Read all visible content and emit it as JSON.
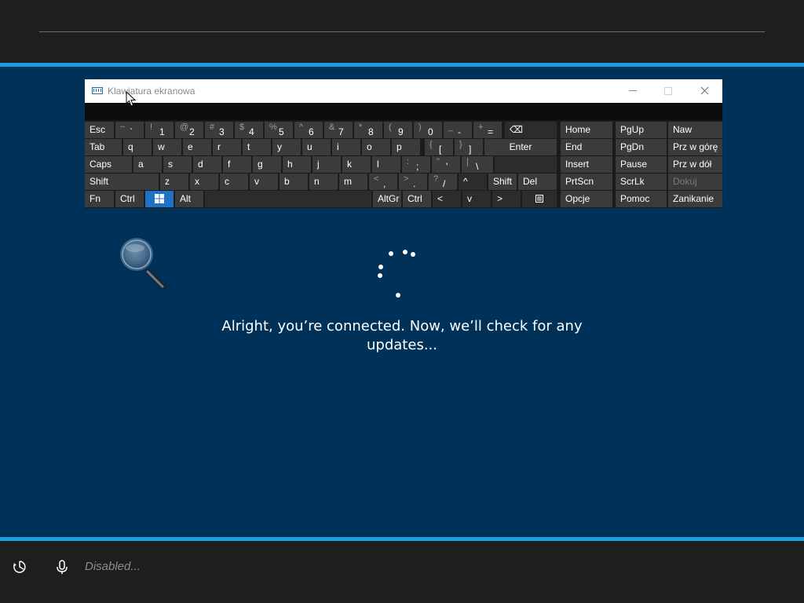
{
  "window": {
    "title": "Klawiatura ekranowa",
    "minimize_icon": "minimize-icon",
    "maximize_icon": "maximize-icon",
    "close_icon": "close-icon"
  },
  "keyboard": {
    "row1": [
      {
        "label": "Esc"
      },
      {
        "shift": "~",
        "primary": "`"
      },
      {
        "shift": "!",
        "primary": "1"
      },
      {
        "shift": "@",
        "primary": "2"
      },
      {
        "shift": "#",
        "primary": "3"
      },
      {
        "shift": "$",
        "primary": "4"
      },
      {
        "shift": "%",
        "primary": "5"
      },
      {
        "shift": "^",
        "primary": "6"
      },
      {
        "shift": "&",
        "primary": "7"
      },
      {
        "shift": "*",
        "primary": "8"
      },
      {
        "shift": "(",
        "primary": "9"
      },
      {
        "shift": ")",
        "primary": "0"
      },
      {
        "shift": "_",
        "primary": "-"
      },
      {
        "shift": "+",
        "primary": "="
      },
      {
        "label": "⌫"
      }
    ],
    "row2": [
      "Tab",
      "q",
      "w",
      "e",
      "r",
      "t",
      "y",
      "u",
      "i",
      "o",
      "p",
      "Enter"
    ],
    "row2_brackets": [
      {
        "shift": "{",
        "primary": "["
      },
      {
        "shift": "}",
        "primary": "]"
      }
    ],
    "row3": [
      "Caps",
      "a",
      "s",
      "d",
      "f",
      "g",
      "h",
      "j",
      "k",
      "l"
    ],
    "row3_punct": [
      {
        "shift": ":",
        "primary": ";"
      },
      {
        "shift": "\"",
        "primary": "'"
      },
      {
        "shift": "|",
        "primary": "\\"
      }
    ],
    "row4": [
      "Shift",
      "z",
      "x",
      "c",
      "v",
      "b",
      "n",
      "m",
      "Shift",
      "Del"
    ],
    "row4_punct": [
      {
        "shift": "<",
        "primary": ","
      },
      {
        "shift": ">",
        "primary": "."
      },
      {
        "shift": "?",
        "primary": "/"
      }
    ],
    "row5": [
      "Fn",
      "Ctrl",
      "Alt",
      "AltGr",
      "Ctrl"
    ],
    "arrows": [
      "^",
      "<",
      "v",
      ">"
    ],
    "nav": [
      [
        "Home",
        "PgUp",
        "Naw"
      ],
      [
        "End",
        "PgDn",
        "Prz w górę"
      ],
      [
        "Insert",
        "Pause",
        "Prz w dół"
      ],
      [
        "PrtScn",
        "ScrLk",
        "Dokuj"
      ],
      [
        "Opcje",
        "Pomoc",
        "Zanikanie"
      ]
    ]
  },
  "status": {
    "message": "Alright, you’re connected. Now, we’ll check for any updates..."
  },
  "bottom": {
    "disabled_label": "Disabled..."
  },
  "colors": {
    "accent": "#1a9ee0",
    "background": "#003259",
    "chrome": "#1d1f1d",
    "windows_key": "#1e73c6"
  }
}
